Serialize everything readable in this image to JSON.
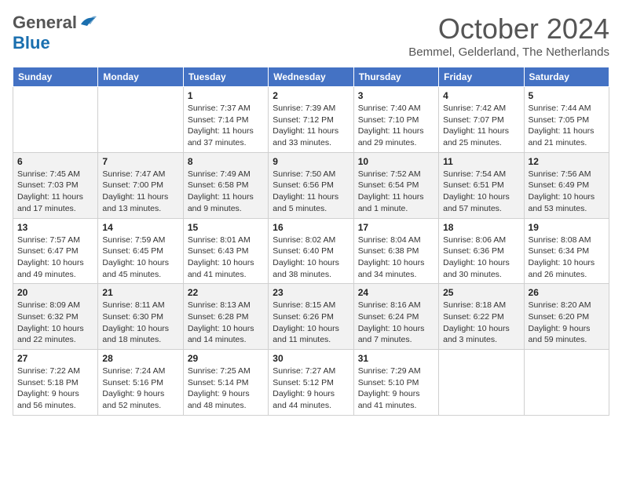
{
  "header": {
    "logo_general": "General",
    "logo_blue": "Blue",
    "title": "October 2024",
    "location": "Bemmel, Gelderland, The Netherlands"
  },
  "days_of_week": [
    "Sunday",
    "Monday",
    "Tuesday",
    "Wednesday",
    "Thursday",
    "Friday",
    "Saturday"
  ],
  "weeks": [
    [
      {
        "day": "",
        "info": ""
      },
      {
        "day": "",
        "info": ""
      },
      {
        "day": "1",
        "info": "Sunrise: 7:37 AM\nSunset: 7:14 PM\nDaylight: 11 hours and 37 minutes."
      },
      {
        "day": "2",
        "info": "Sunrise: 7:39 AM\nSunset: 7:12 PM\nDaylight: 11 hours and 33 minutes."
      },
      {
        "day": "3",
        "info": "Sunrise: 7:40 AM\nSunset: 7:10 PM\nDaylight: 11 hours and 29 minutes."
      },
      {
        "day": "4",
        "info": "Sunrise: 7:42 AM\nSunset: 7:07 PM\nDaylight: 11 hours and 25 minutes."
      },
      {
        "day": "5",
        "info": "Sunrise: 7:44 AM\nSunset: 7:05 PM\nDaylight: 11 hours and 21 minutes."
      }
    ],
    [
      {
        "day": "6",
        "info": "Sunrise: 7:45 AM\nSunset: 7:03 PM\nDaylight: 11 hours and 17 minutes."
      },
      {
        "day": "7",
        "info": "Sunrise: 7:47 AM\nSunset: 7:00 PM\nDaylight: 11 hours and 13 minutes."
      },
      {
        "day": "8",
        "info": "Sunrise: 7:49 AM\nSunset: 6:58 PM\nDaylight: 11 hours and 9 minutes."
      },
      {
        "day": "9",
        "info": "Sunrise: 7:50 AM\nSunset: 6:56 PM\nDaylight: 11 hours and 5 minutes."
      },
      {
        "day": "10",
        "info": "Sunrise: 7:52 AM\nSunset: 6:54 PM\nDaylight: 11 hours and 1 minute."
      },
      {
        "day": "11",
        "info": "Sunrise: 7:54 AM\nSunset: 6:51 PM\nDaylight: 10 hours and 57 minutes."
      },
      {
        "day": "12",
        "info": "Sunrise: 7:56 AM\nSunset: 6:49 PM\nDaylight: 10 hours and 53 minutes."
      }
    ],
    [
      {
        "day": "13",
        "info": "Sunrise: 7:57 AM\nSunset: 6:47 PM\nDaylight: 10 hours and 49 minutes."
      },
      {
        "day": "14",
        "info": "Sunrise: 7:59 AM\nSunset: 6:45 PM\nDaylight: 10 hours and 45 minutes."
      },
      {
        "day": "15",
        "info": "Sunrise: 8:01 AM\nSunset: 6:43 PM\nDaylight: 10 hours and 41 minutes."
      },
      {
        "day": "16",
        "info": "Sunrise: 8:02 AM\nSunset: 6:40 PM\nDaylight: 10 hours and 38 minutes."
      },
      {
        "day": "17",
        "info": "Sunrise: 8:04 AM\nSunset: 6:38 PM\nDaylight: 10 hours and 34 minutes."
      },
      {
        "day": "18",
        "info": "Sunrise: 8:06 AM\nSunset: 6:36 PM\nDaylight: 10 hours and 30 minutes."
      },
      {
        "day": "19",
        "info": "Sunrise: 8:08 AM\nSunset: 6:34 PM\nDaylight: 10 hours and 26 minutes."
      }
    ],
    [
      {
        "day": "20",
        "info": "Sunrise: 8:09 AM\nSunset: 6:32 PM\nDaylight: 10 hours and 22 minutes."
      },
      {
        "day": "21",
        "info": "Sunrise: 8:11 AM\nSunset: 6:30 PM\nDaylight: 10 hours and 18 minutes."
      },
      {
        "day": "22",
        "info": "Sunrise: 8:13 AM\nSunset: 6:28 PM\nDaylight: 10 hours and 14 minutes."
      },
      {
        "day": "23",
        "info": "Sunrise: 8:15 AM\nSunset: 6:26 PM\nDaylight: 10 hours and 11 minutes."
      },
      {
        "day": "24",
        "info": "Sunrise: 8:16 AM\nSunset: 6:24 PM\nDaylight: 10 hours and 7 minutes."
      },
      {
        "day": "25",
        "info": "Sunrise: 8:18 AM\nSunset: 6:22 PM\nDaylight: 10 hours and 3 minutes."
      },
      {
        "day": "26",
        "info": "Sunrise: 8:20 AM\nSunset: 6:20 PM\nDaylight: 9 hours and 59 minutes."
      }
    ],
    [
      {
        "day": "27",
        "info": "Sunrise: 7:22 AM\nSunset: 5:18 PM\nDaylight: 9 hours and 56 minutes."
      },
      {
        "day": "28",
        "info": "Sunrise: 7:24 AM\nSunset: 5:16 PM\nDaylight: 9 hours and 52 minutes."
      },
      {
        "day": "29",
        "info": "Sunrise: 7:25 AM\nSunset: 5:14 PM\nDaylight: 9 hours and 48 minutes."
      },
      {
        "day": "30",
        "info": "Sunrise: 7:27 AM\nSunset: 5:12 PM\nDaylight: 9 hours and 44 minutes."
      },
      {
        "day": "31",
        "info": "Sunrise: 7:29 AM\nSunset: 5:10 PM\nDaylight: 9 hours and 41 minutes."
      },
      {
        "day": "",
        "info": ""
      },
      {
        "day": "",
        "info": ""
      }
    ]
  ]
}
